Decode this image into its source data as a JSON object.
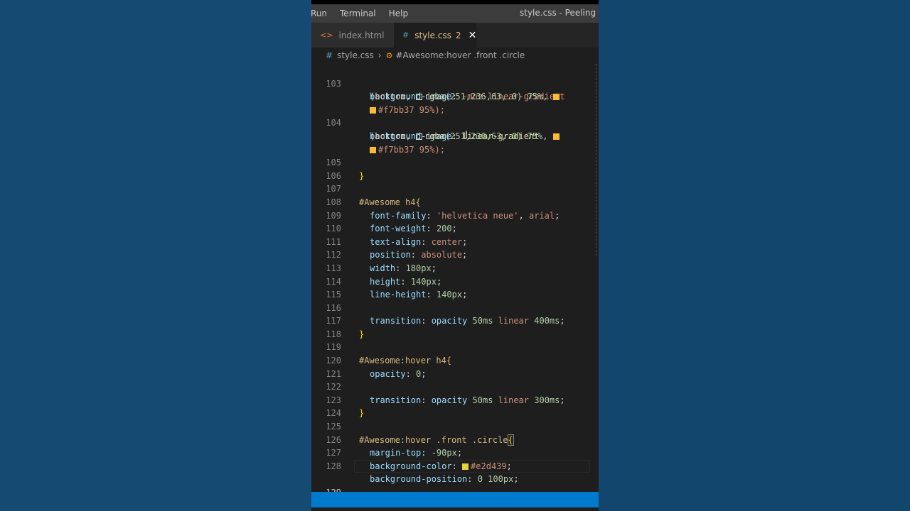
{
  "menubar": {
    "items": [
      "Run",
      "Terminal",
      "Help"
    ],
    "window_title": "style.css - Peeling Stic"
  },
  "tabs": [
    {
      "label": "index.html",
      "icon": "html-icon"
    },
    {
      "label": "style.css",
      "icon": "css-icon",
      "problems": "2",
      "close": "✕"
    }
  ],
  "breadcrumb": {
    "file": "style.css",
    "symbol": "#Awesome:hover .front .circle"
  },
  "colors": {
    "swatch_rgba_yellow": "#fbec3f",
    "swatch_f7bb37": "#f7bb37",
    "swatch_e2d439": "#e2d439"
  },
  "lines": {
    "n103": "103",
    "n104": "104",
    "n105": "105",
    "n106": "106",
    "n107": "107",
    "n108": "108",
    "n109": "109",
    "n110": "110",
    "n111": "111",
    "n112": "112",
    "n113": "113",
    "n114": "114",
    "n115": "115",
    "n116": "116",
    "n117": "117",
    "n118": "118",
    "n119": "119",
    "n120": "120",
    "n121": "121",
    "n122": "122",
    "n123": "123",
    "n124": "124",
    "n125": "125",
    "n126": "126",
    "n127": "127",
    "n128": "128",
    "n129": "129"
  },
  "code": {
    "l103_prop": "background-image",
    "l103_val": "-moz-linear-gradient",
    "l103b_open": "(bottom, ",
    "l103b_fn": "rgba",
    "l103b_args": "(251,236,63,.0) 75%, ",
    "l103c_val": "#f7bb37 95%);",
    "l104_prop": "background-image",
    "l104_val": "linear-gradient",
    "l104b_open": "(bottom, ",
    "l104b_fn": "rgba",
    "l104b_args": "(251,236,63,.0) 75%, ",
    "l104c_val": "#f7bb37 95%);",
    "close_brace": "}",
    "l107_sel": "#Awesome h4{",
    "l108_prop": "font-family",
    "l108_val1": "'helvetica neue'",
    "l108_val2": "arial",
    "l109_prop": "font-weight",
    "l109_val": "200",
    "l110_prop": "text-align",
    "l110_val": "center",
    "l111_prop": "position",
    "l111_val": "absolute",
    "l112_prop": "width",
    "l112_val": "180px",
    "l113_prop": "height",
    "l113_val": "140px",
    "l114_prop": "line-height",
    "l114_val": "140px",
    "l116_prop": "transition",
    "l116_v1": "opacity",
    "l116_v2": "50ms",
    "l116_v3": "linear",
    "l116_v4": "400ms",
    "l119_sel": "#Awesome:hover h4{",
    "l120_prop": "opacity",
    "l120_val": "0",
    "l122_prop": "transition",
    "l122_v1": "opacity",
    "l122_v2": "50ms",
    "l122_v3": "linear",
    "l122_v4": "300ms",
    "l125_sel": "#Awesome:hover .front .circle",
    "l125_brace": "{",
    "l126_prop": "margin-top",
    "l126_val": "-90px",
    "l127_prop": "background-color",
    "l127_val": "#e2d439",
    "l128_prop": "background-position",
    "l128_val": "0 100px"
  }
}
